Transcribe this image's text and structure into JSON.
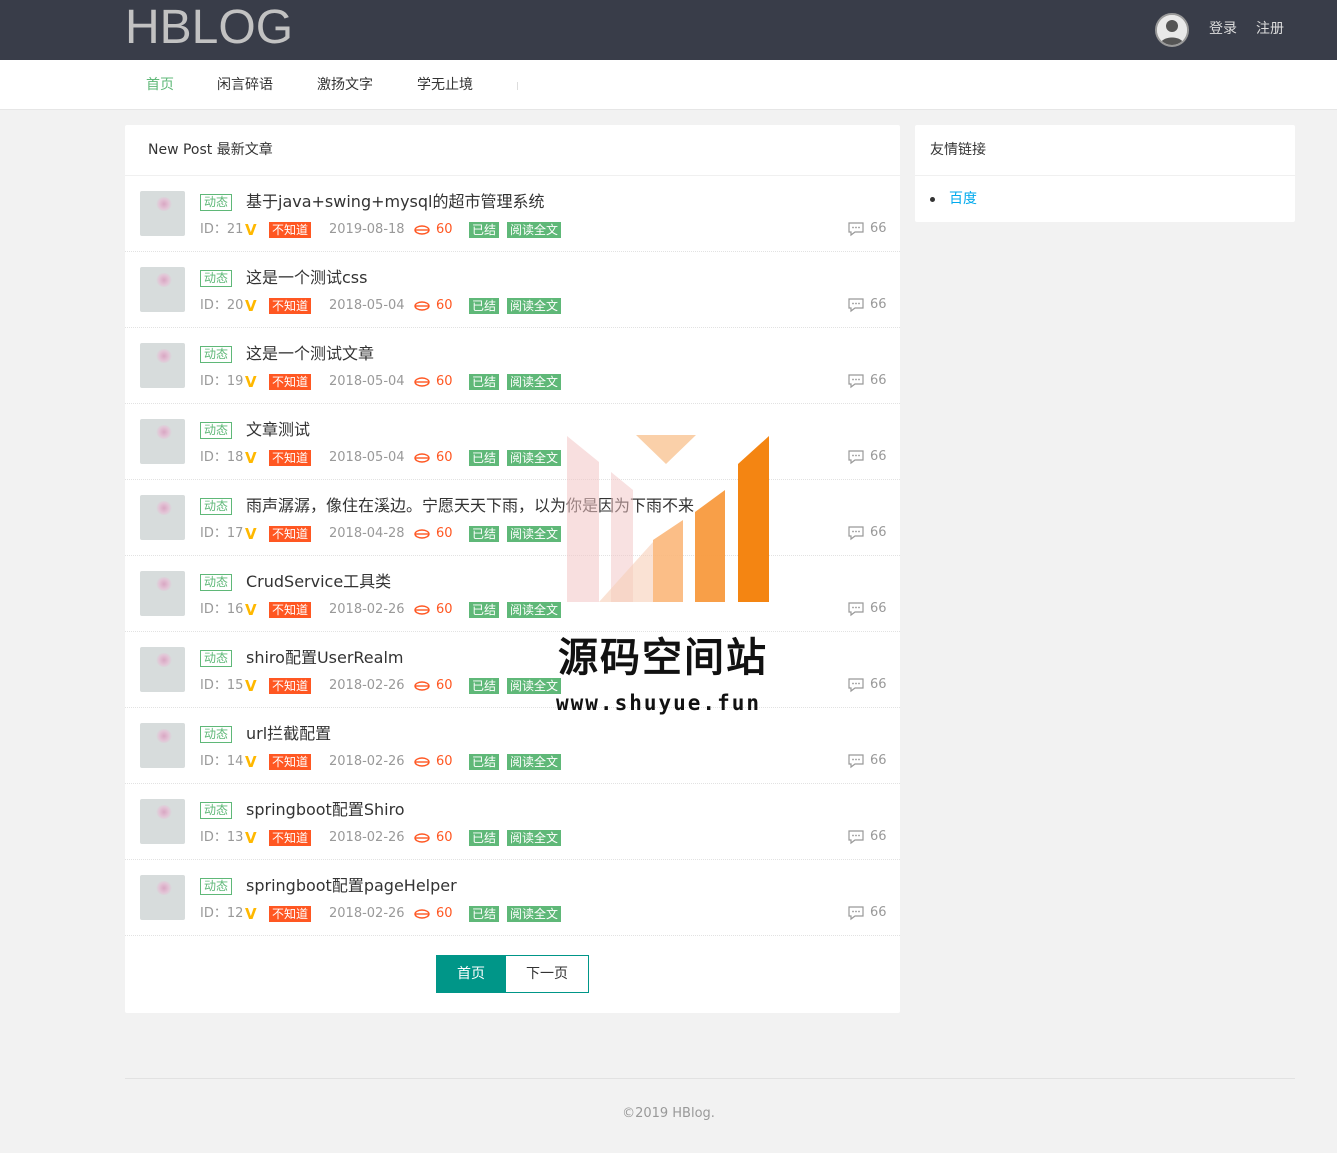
{
  "header": {
    "logo": "HBLOG",
    "login": "登录",
    "register": "注册"
  },
  "nav": {
    "items": [
      {
        "label": "首页",
        "active": true
      },
      {
        "label": "闲言碎语",
        "active": false
      },
      {
        "label": "激扬文字",
        "active": false
      },
      {
        "label": "学无止境",
        "active": false
      }
    ]
  },
  "main": {
    "title": "New Post 最新文章",
    "tag_label": "动态",
    "badges": {
      "unknown": "不知道",
      "done": "已结",
      "read": "阅读全文"
    },
    "posts": [
      {
        "title": "基于java+swing+mysql的超市管理系统",
        "id": "ID：21",
        "date": "2019-08-18",
        "views": "60",
        "comments": "66"
      },
      {
        "title": "这是一个测试css",
        "id": "ID：20",
        "date": "2018-05-04",
        "views": "60",
        "comments": "66"
      },
      {
        "title": "这是一个测试文章",
        "id": "ID：19",
        "date": "2018-05-04",
        "views": "60",
        "comments": "66"
      },
      {
        "title": "文章测试",
        "id": "ID：18",
        "date": "2018-05-04",
        "views": "60",
        "comments": "66"
      },
      {
        "title": "雨声潺潺，像住在溪边。宁愿天天下雨，以为你是因为下雨不来",
        "id": "ID：17",
        "date": "2018-04-28",
        "views": "60",
        "comments": "66"
      },
      {
        "title": "CrudService工具类",
        "id": "ID：16",
        "date": "2018-02-26",
        "views": "60",
        "comments": "66"
      },
      {
        "title": "shiro配置UserRealm",
        "id": "ID：15",
        "date": "2018-02-26",
        "views": "60",
        "comments": "66"
      },
      {
        "title": "url拦截配置",
        "id": "ID：14",
        "date": "2018-02-26",
        "views": "60",
        "comments": "66"
      },
      {
        "title": "springboot配置Shiro",
        "id": "ID：13",
        "date": "2018-02-26",
        "views": "60",
        "comments": "66"
      },
      {
        "title": "springboot配置pageHelper",
        "id": "ID：12",
        "date": "2018-02-26",
        "views": "60",
        "comments": "66"
      }
    ],
    "pager": {
      "first": "首页",
      "next": "下一页"
    }
  },
  "sidebar": {
    "title": "友情链接",
    "links": [
      "百度"
    ]
  },
  "footer": {
    "copyright": "©2019 HBlog."
  },
  "watermark": {
    "title": "源码空间站",
    "url": "www.shuyue.fun"
  },
  "colors": {
    "topbar": "#393d49",
    "accent": "#5fb878",
    "danger": "#ff5722",
    "primary": "#009688",
    "link": "#01aaed",
    "vip": "#ffb800"
  }
}
